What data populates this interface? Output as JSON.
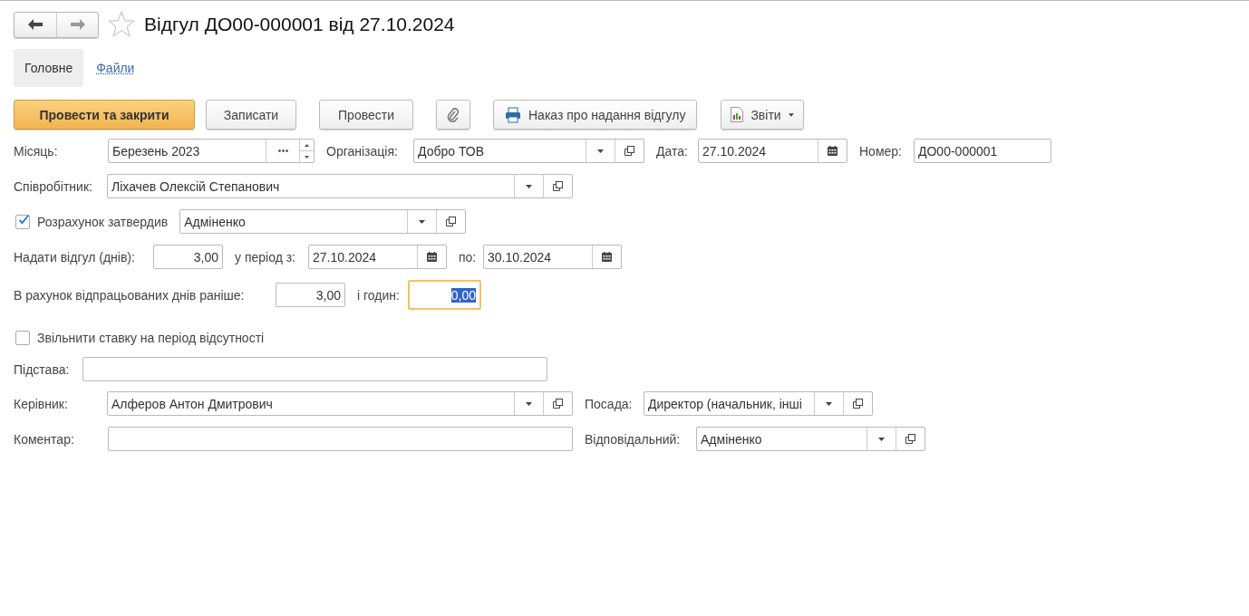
{
  "nav": {
    "back_enabled": true,
    "forward_enabled": false
  },
  "window": {
    "title": "Відгул ДО00-000001 від 27.10.2024",
    "favorite": false
  },
  "tabs": [
    {
      "label": "Головне",
      "selected": true
    },
    {
      "label": "Файли",
      "selected": false
    }
  ],
  "toolbar": [
    {
      "kind": "primary",
      "label": "Провести та закрити"
    },
    {
      "kind": "plain",
      "label": "Записати"
    },
    {
      "kind": "plain",
      "label": "Провести"
    },
    {
      "kind": "attach"
    },
    {
      "kind": "print",
      "label": "Наказ про надання відгулу"
    },
    {
      "kind": "menu",
      "label": "Звіти"
    }
  ],
  "rows": [
    {
      "items": [
        {
          "kind": "label",
          "text": "Місяць:"
        },
        {
          "kind": "month",
          "value": "Березень 2023",
          "focused": false
        },
        {
          "kind": "label",
          "text": "Організація:"
        },
        {
          "kind": "select",
          "value": "Добро ТОВ",
          "focused": false
        },
        {
          "kind": "label",
          "text": "Дата:"
        },
        {
          "kind": "date",
          "value": "27.10.2024",
          "focused": false
        },
        {
          "kind": "label",
          "text": "Номер:"
        },
        {
          "kind": "text",
          "value": "ДО00-000001",
          "focused": false
        }
      ]
    },
    {
      "items": [
        {
          "kind": "label",
          "text": "Співробітник:"
        },
        {
          "kind": "select",
          "value": "Ліхачев Олексій Степанович",
          "focused": false
        }
      ]
    },
    {
      "items": [
        {
          "kind": "check",
          "text": "Розрахунок затвердив",
          "checked": true
        },
        {
          "kind": "select",
          "value": "Адміненко",
          "focused": false
        }
      ]
    },
    {
      "items": [
        {
          "kind": "label",
          "text": "Надати відгул (днів):"
        },
        {
          "kind": "number",
          "value": "3,00",
          "focused": false
        },
        {
          "kind": "label",
          "text": "у період з:"
        },
        {
          "kind": "date",
          "value": "27.10.2024",
          "focused": false
        },
        {
          "kind": "label",
          "text": "по:"
        },
        {
          "kind": "date",
          "value": "30.10.2024",
          "focused": false
        }
      ]
    },
    {
      "items": [
        {
          "kind": "label",
          "text": "В рахунок відпрацьованих днів раніше:"
        },
        {
          "kind": "number",
          "value": "3,00",
          "focused": false
        },
        {
          "kind": "label",
          "text": "і годин:"
        },
        {
          "kind": "number",
          "value": "0,00",
          "focused": true
        }
      ]
    },
    {
      "items": [
        {
          "kind": "check",
          "text": "Звільнити ставку на період відсутності",
          "checked": false
        }
      ]
    },
    {
      "items": [
        {
          "kind": "label",
          "text": "Підстава:"
        },
        {
          "kind": "text",
          "focused": false
        }
      ]
    },
    {
      "items": [
        {
          "kind": "label",
          "text": "Керівник:"
        },
        {
          "kind": "select",
          "value": "Алферов Антон Дмитрович",
          "focused": false
        },
        {
          "kind": "label",
          "text": "Посада:"
        },
        {
          "kind": "select",
          "value": "Директор (начальник, інші",
          "focused": false
        }
      ]
    },
    {
      "items": [
        {
          "kind": "label",
          "text": "Коментар:"
        },
        {
          "kind": "text",
          "focused": false
        },
        {
          "kind": "label",
          "text": "Відповідальний:"
        },
        {
          "kind": "select",
          "value": "Адміненко",
          "focused": false
        }
      ]
    }
  ]
}
